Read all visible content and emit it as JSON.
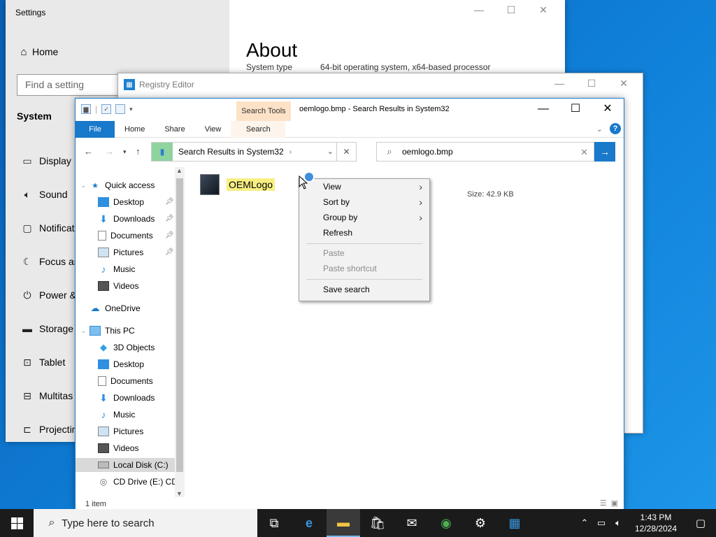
{
  "settings": {
    "title": "Settings",
    "home_label": "Home",
    "search_placeholder": "Find a setting",
    "section_label": "System",
    "nav_items": [
      {
        "label": "Display",
        "icon": "monitor-icon"
      },
      {
        "label": "Sound",
        "icon": "speaker-icon"
      },
      {
        "label": "Notificat",
        "icon": "notification-icon"
      },
      {
        "label": "Focus as",
        "icon": "moon-icon"
      },
      {
        "label": "Power &",
        "icon": "power-icon"
      },
      {
        "label": "Storage",
        "icon": "storage-icon"
      },
      {
        "label": "Tablet",
        "icon": "tablet-icon"
      },
      {
        "label": "Multitas",
        "icon": "multitasking-icon"
      },
      {
        "label": "Projectin",
        "icon": "projecting-icon"
      }
    ],
    "page_title": "About",
    "system_type_label": "System type",
    "system_type_value": "64-bit operating system, x64-based processor"
  },
  "regedit": {
    "title": "Registry Editor"
  },
  "explorer": {
    "search_tools_label": "Search Tools",
    "window_title": "oemlogo.bmp - Search Results in System32",
    "ribbon_tabs": [
      "File",
      "Home",
      "Share",
      "View",
      "Search"
    ],
    "address": "Search Results in System32",
    "search_value": "oemlogo.bmp",
    "nav": {
      "quick_access": "Quick access",
      "qa_items": [
        "Desktop",
        "Downloads",
        "Documents",
        "Pictures",
        "Music",
        "Videos"
      ],
      "onedrive": "OneDrive",
      "this_pc": "This PC",
      "pc_items": [
        "3D Objects",
        "Desktop",
        "Documents",
        "Downloads",
        "Music",
        "Pictures",
        "Videos",
        "Local Disk (C:)",
        "CD Drive (E:) CDI"
      ]
    },
    "file": {
      "name": "OEMLogo",
      "size": "Size: 42.9 KB"
    },
    "status": "1 item"
  },
  "context_menu": {
    "items": [
      {
        "label": "View",
        "submenu": true,
        "enabled": true
      },
      {
        "label": "Sort by",
        "submenu": true,
        "enabled": true
      },
      {
        "label": "Group by",
        "submenu": true,
        "enabled": true
      },
      {
        "label": "Refresh",
        "submenu": false,
        "enabled": true
      },
      {
        "label": "Paste",
        "submenu": false,
        "enabled": false
      },
      {
        "label": "Paste shortcut",
        "submenu": false,
        "enabled": false
      },
      {
        "label": "Save search",
        "submenu": false,
        "enabled": true
      }
    ]
  },
  "taskbar": {
    "search_placeholder": "Type here to search",
    "time": "1:43 PM",
    "date": "12/28/2024"
  },
  "colors": {
    "accent": "#1979ca",
    "search_tools_bg": "#fde2c8",
    "highlight": "#f7ef82",
    "taskbar": "#1b1b1b"
  }
}
